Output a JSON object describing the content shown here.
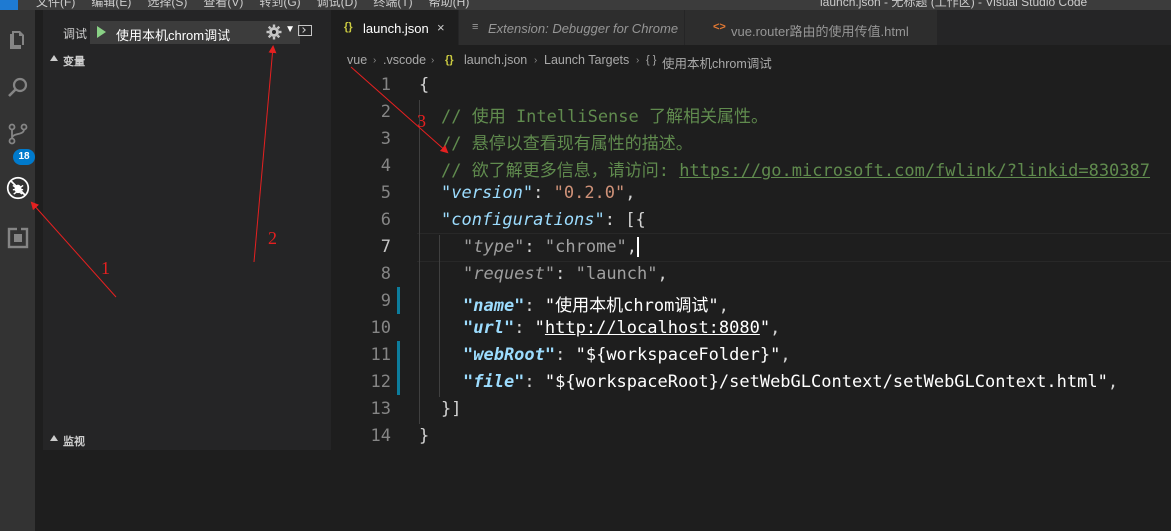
{
  "window": {
    "menu": [
      "文件(F)",
      "编辑(E)",
      "选择(S)",
      "查看(V)",
      "转到(G)",
      "调试(D)",
      "终端(T)",
      "帮助(H)"
    ],
    "title": "launch.json - 无标题 (工作区) - Visual Studio Code"
  },
  "activity_bar": {
    "items": [
      {
        "name": "explorer-icon"
      },
      {
        "name": "search-icon"
      },
      {
        "name": "source-control-icon",
        "badge": "18"
      },
      {
        "name": "debug-icon",
        "active": true
      },
      {
        "name": "extensions-icon"
      }
    ]
  },
  "debug_panel": {
    "label": "调试",
    "config_select": "使用本机chrom调试",
    "sections": {
      "variables": "变量",
      "watch": "监视"
    }
  },
  "tabs": [
    {
      "icon": "{}",
      "label": "launch.json",
      "active": true,
      "close": "×"
    },
    {
      "icon": "≡",
      "label": "Extension: Debugger for Chrome",
      "active": false
    },
    {
      "icon": "<>",
      "label": "vue.router路由的使用传值.html",
      "active": false
    }
  ],
  "breadcrumb": {
    "vue": "vue",
    "vscode": ".vscode",
    "file_icon": "{}",
    "file": "launch.json",
    "targets": "Launch Targets",
    "config_icon": "{ }",
    "config": "使用本机chrom调试"
  },
  "editor": {
    "line_numbers": [
      "1",
      "2",
      "3",
      "4",
      "5",
      "6",
      "7",
      "8",
      "9",
      "10",
      "11",
      "12",
      "13",
      "14"
    ],
    "current_line": 7,
    "lines": {
      "l1": "{",
      "l2": "// 使用 IntelliSense 了解相关属性。",
      "l3": "// 悬停以查看现有属性的描述。",
      "l4_prefix": "// 欲了解更多信息，请访问: ",
      "l4_url": "https://go.microsoft.com/fwlink/?linkid=830387",
      "version_key": "\"version\"",
      "version_val": "\"0.2.0\"",
      "configurations_key": "\"configurations\"",
      "type_key": "\"type\"",
      "type_val": "\"chrome\"",
      "request_key": "\"request\"",
      "request_val": "\"launch\"",
      "name_key": "\"name\"",
      "name_val": "\"使用本机chrom调试\"",
      "url_key": "\"url\"",
      "url_val_q1": "\"",
      "url_val": "http://localhost:8080",
      "url_val_q2": "\"",
      "webroot_key": "\"webRoot\"",
      "webroot_val": "\"${workspaceFolder}\"",
      "file_key": "\"file\"",
      "file_val": "\"${workspaceRoot}/setWebGLContext/setWebGLContext.html\"",
      "l13": "}]",
      "l14": "}"
    }
  },
  "annotations": {
    "a1": "1",
    "a2": "2",
    "a3": "3",
    "color": "#e52020"
  },
  "colors": {
    "activity_bar": "#333333",
    "sidebar": "#252526",
    "editor": "#1e1e1e",
    "accent": "#007acc"
  }
}
